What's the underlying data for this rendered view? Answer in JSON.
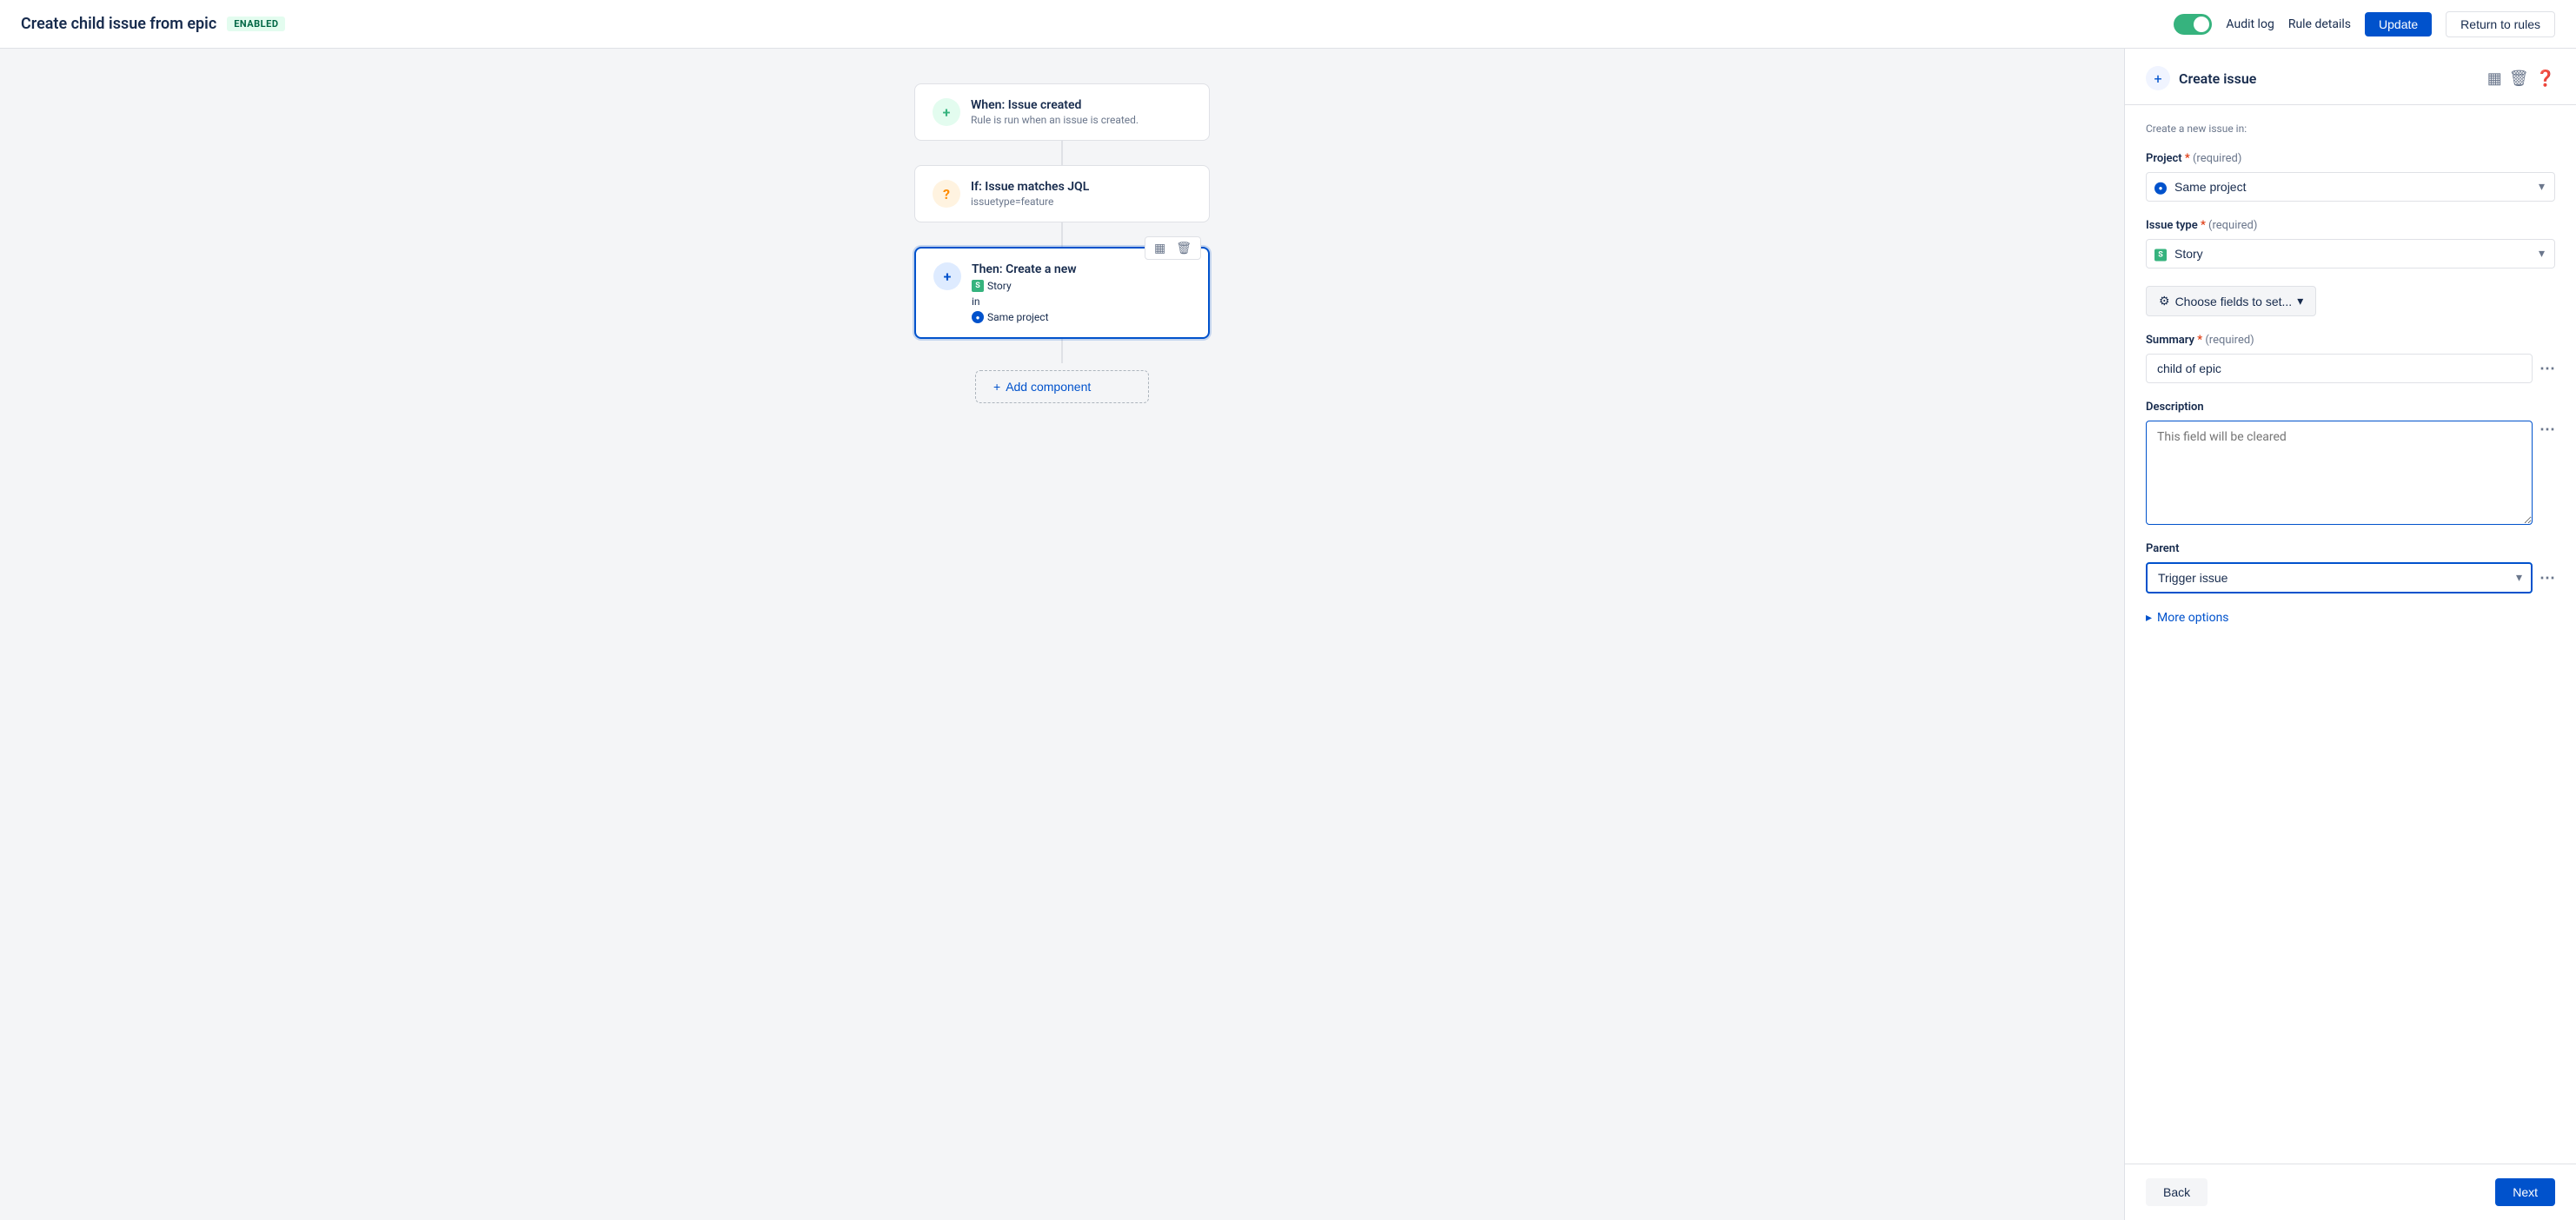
{
  "header": {
    "title": "Create child issue from epic",
    "badge": "ENABLED",
    "audit_log": "Audit log",
    "rule_details": "Rule details",
    "update_btn": "Update",
    "return_btn": "Return to rules"
  },
  "flow": {
    "nodes": [
      {
        "id": "trigger",
        "type": "trigger",
        "icon_type": "green",
        "title": "When: Issue created",
        "subtitle": "Rule is run when an issue is created."
      },
      {
        "id": "condition",
        "type": "condition",
        "icon_type": "orange",
        "title": "If: Issue matches JQL",
        "subtitle": "issuetype=feature"
      },
      {
        "id": "action",
        "type": "action",
        "icon_type": "blue",
        "title": "Then: Create a new",
        "story": "Story",
        "in_label": "in",
        "project": "Same project",
        "active": true
      }
    ],
    "add_component_btn": "Add component"
  },
  "panel": {
    "title": "Create issue",
    "subtitle": "Create a new issue in:",
    "project_label": "Project",
    "project_required": "(required)",
    "project_value": "Same project",
    "issue_type_label": "Issue type",
    "issue_type_required": "(required)",
    "issue_type_value": "Story",
    "choose_fields_btn": "Choose fields to set...",
    "summary_label": "Summary",
    "summary_required": "(required)",
    "summary_value": "child of epic",
    "description_label": "Description",
    "description_placeholder": "This field will be cleared",
    "parent_label": "Parent",
    "parent_value": "Trigger issue",
    "more_options_label": "More options",
    "back_btn": "Back",
    "next_btn": "Next"
  }
}
